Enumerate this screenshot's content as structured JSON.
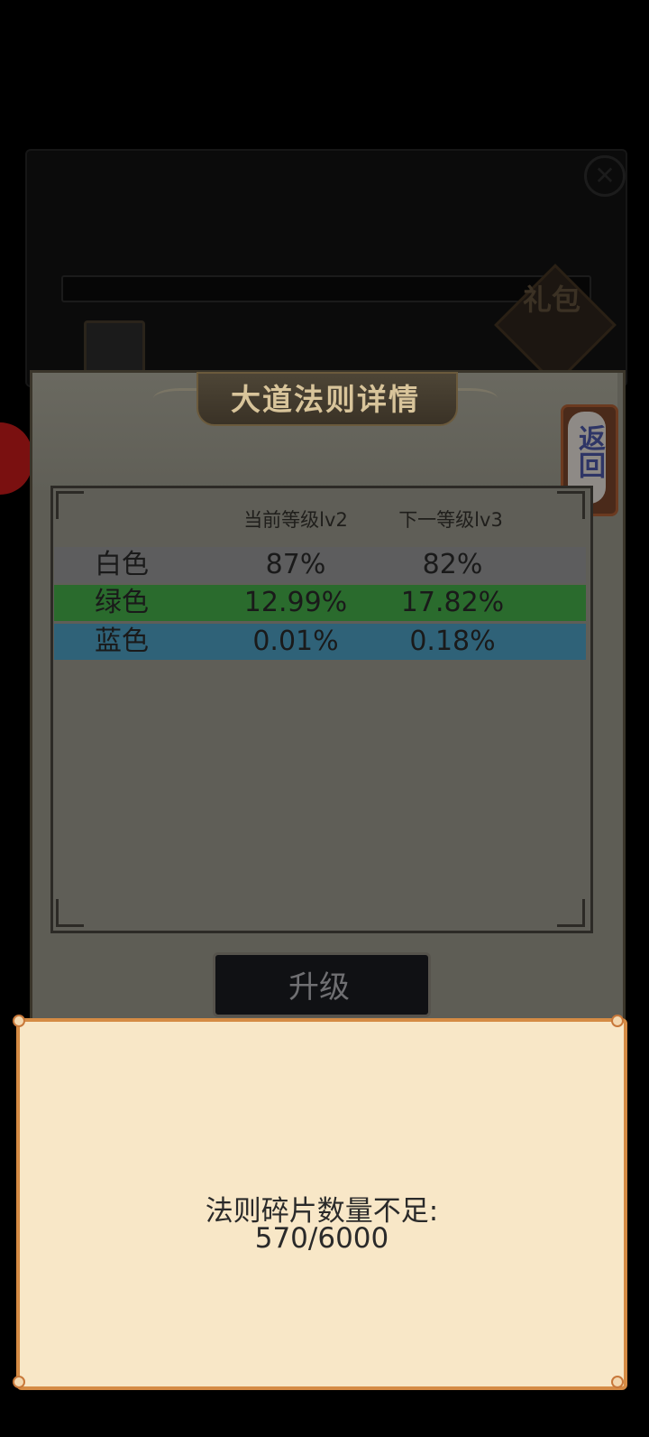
{
  "background": {
    "title": "",
    "subtitle": "",
    "gift_label": "礼包"
  },
  "panel": {
    "title": "大道法则详情",
    "back_label": "返回",
    "headers": [
      "当前等级lv2",
      "下一等级lv3"
    ],
    "rows": [
      {
        "name": "白色",
        "current": "87%",
        "next": "82%",
        "color": "#5d5d5e"
      },
      {
        "name": "绿色",
        "current": "12.99%",
        "next": "17.82%",
        "color": "#2a6b2d"
      },
      {
        "name": "蓝色",
        "current": "0.01%",
        "next": "0.18%",
        "color": "#2f6278"
      }
    ],
    "upgrade_label": "升级"
  },
  "toast": {
    "message": "法则碎片数量不足:",
    "progress": "570/6000"
  }
}
